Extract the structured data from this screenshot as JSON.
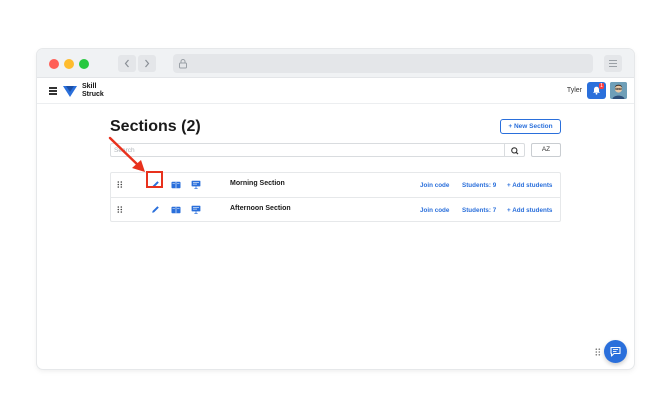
{
  "app": {
    "brand_line1": "Skill",
    "brand_line2": "Struck",
    "user_name": "Tyler",
    "notification_count": "1",
    "accent_color": "#2a6fdb"
  },
  "page": {
    "title": "Sections (2)",
    "new_section_label": "+ New Section",
    "search_placeholder": "Search",
    "sort_label": "AZ"
  },
  "sections": [
    {
      "name": "Morning Section",
      "join_label": "Join code",
      "students_label": "Students: 9",
      "add_label": "+ Add students"
    },
    {
      "name": "Afternoon Section",
      "join_label": "Join code",
      "students_label": "Students: 7",
      "add_label": "+ Add students"
    }
  ],
  "icons": {
    "drag": "drag-handle-icon",
    "edit": "pencil-icon",
    "book": "book-icon",
    "present": "presentation-icon",
    "search": "search-icon",
    "chat": "chat-icon",
    "bell": "bell-icon"
  }
}
